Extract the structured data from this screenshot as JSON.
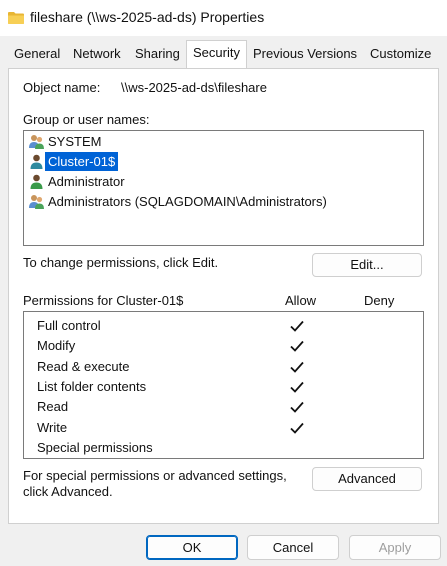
{
  "window": {
    "title": "fileshare (\\\\ws-2025-ad-ds) Properties"
  },
  "tabs": [
    {
      "label": "General"
    },
    {
      "label": "Network"
    },
    {
      "label": "Sharing"
    },
    {
      "label": "Security",
      "active": true
    },
    {
      "label": "Previous Versions"
    },
    {
      "label": "Customize"
    }
  ],
  "security": {
    "object_name_label": "Object name:",
    "object_name_value": "\\\\ws-2025-ad-ds\\fileshare",
    "group_label": "Group or user names:",
    "users": [
      {
        "name": "SYSTEM",
        "icon": "group-users-icon"
      },
      {
        "name": "Cluster-01$",
        "icon": "user-icon",
        "selected": true
      },
      {
        "name": "Administrator",
        "icon": "user-icon"
      },
      {
        "name": "Administrators (SQLAGDOMAIN\\Administrators)",
        "icon": "group-users-icon"
      }
    ],
    "change_hint": "To change permissions, click Edit.",
    "edit_label": "Edit...",
    "permissions_for": "Permissions for Cluster-01$",
    "allow_header": "Allow",
    "deny_header": "Deny",
    "permissions": [
      {
        "name": "Full control",
        "allow": true,
        "deny": false
      },
      {
        "name": "Modify",
        "allow": true,
        "deny": false
      },
      {
        "name": "Read & execute",
        "allow": true,
        "deny": false
      },
      {
        "name": "List folder contents",
        "allow": true,
        "deny": false
      },
      {
        "name": "Read",
        "allow": true,
        "deny": false
      },
      {
        "name": "Write",
        "allow": true,
        "deny": false
      },
      {
        "name": "Special permissions",
        "allow": false,
        "deny": false
      }
    ],
    "advanced_hint_line1": "For special permissions or advanced settings,",
    "advanced_hint_line2": "click Advanced.",
    "advanced_label": "Advanced"
  },
  "footer": {
    "ok_label": "OK",
    "cancel_label": "Cancel",
    "apply_label": "Apply"
  },
  "colors": {
    "selection": "#0063d6",
    "primary_border": "#0067c0",
    "folder_yellow": "#f4c542"
  }
}
